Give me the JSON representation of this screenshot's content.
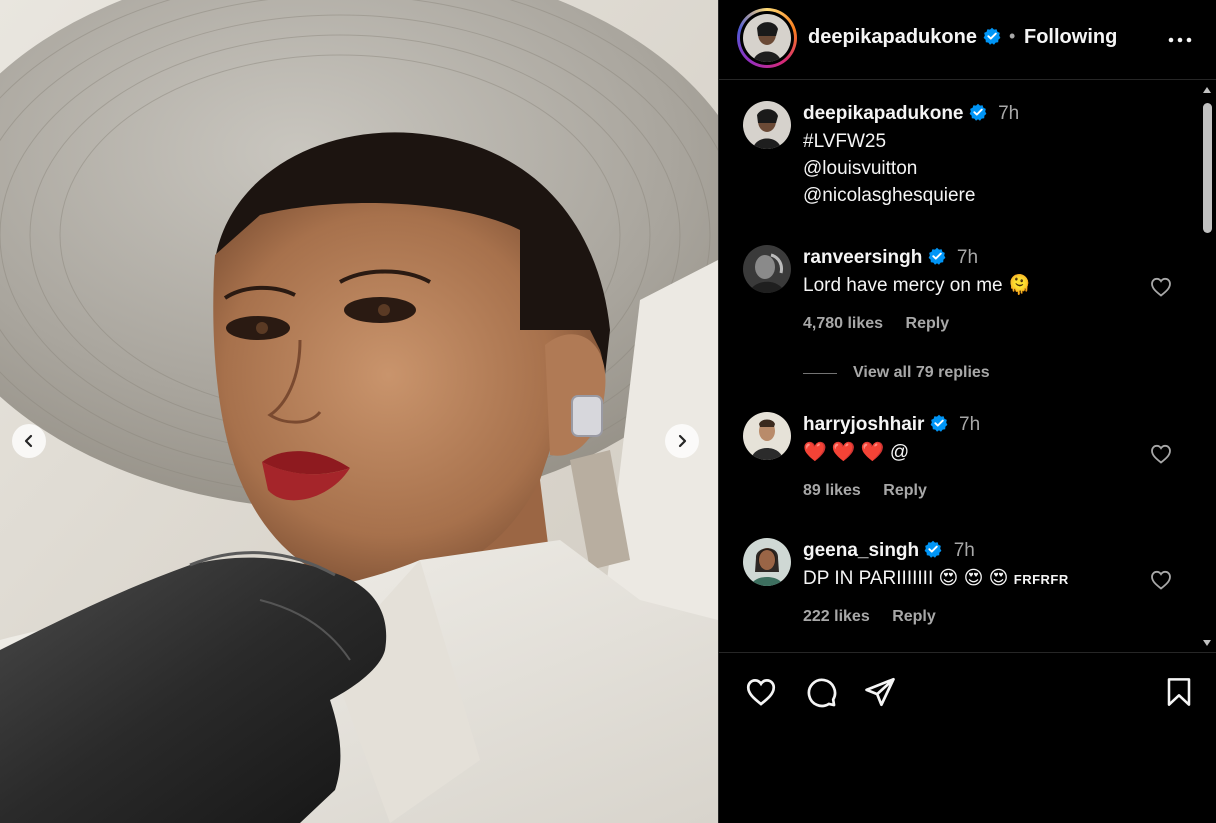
{
  "post": {
    "author": "deepikapadukone",
    "separator": "•",
    "follow_status": "Following"
  },
  "caption": {
    "author": "deepikapadukone",
    "time": "7h",
    "lines": [
      "#LVFW25",
      "@louisvuitton",
      "@nicolasghesquiere"
    ]
  },
  "comments": [
    {
      "user": "ranveersingh",
      "time": "7h",
      "text": "Lord have mercy on me",
      "emoji": "🫠",
      "likes": "4,780 likes",
      "reply": "Reply"
    },
    {
      "user": "harryjoshhair",
      "time": "7h",
      "text": "@",
      "emoji": "❤️ ❤️ ❤️",
      "likes": "89 likes",
      "reply": "Reply"
    },
    {
      "user": "geena_singh",
      "time": "7h",
      "text": "DP IN PARIIIIIII",
      "emoji": "😍 😍 😍",
      "suffix": "FRFRFR",
      "likes": "222 likes",
      "reply": "Reply"
    }
  ],
  "view_replies": "View all 79 replies",
  "icons": {
    "verified": "verified-badge-icon",
    "more": "more-options-icon",
    "like": "heart-icon",
    "comment": "comment-icon",
    "share": "share-icon",
    "save": "bookmark-icon",
    "prev": "chevron-left-icon",
    "next": "chevron-right-icon"
  },
  "colors": {
    "background": "#000000",
    "verified": "#0095f6",
    "muted": "#a8a8a8",
    "lipstick": "#8e1a1f"
  }
}
